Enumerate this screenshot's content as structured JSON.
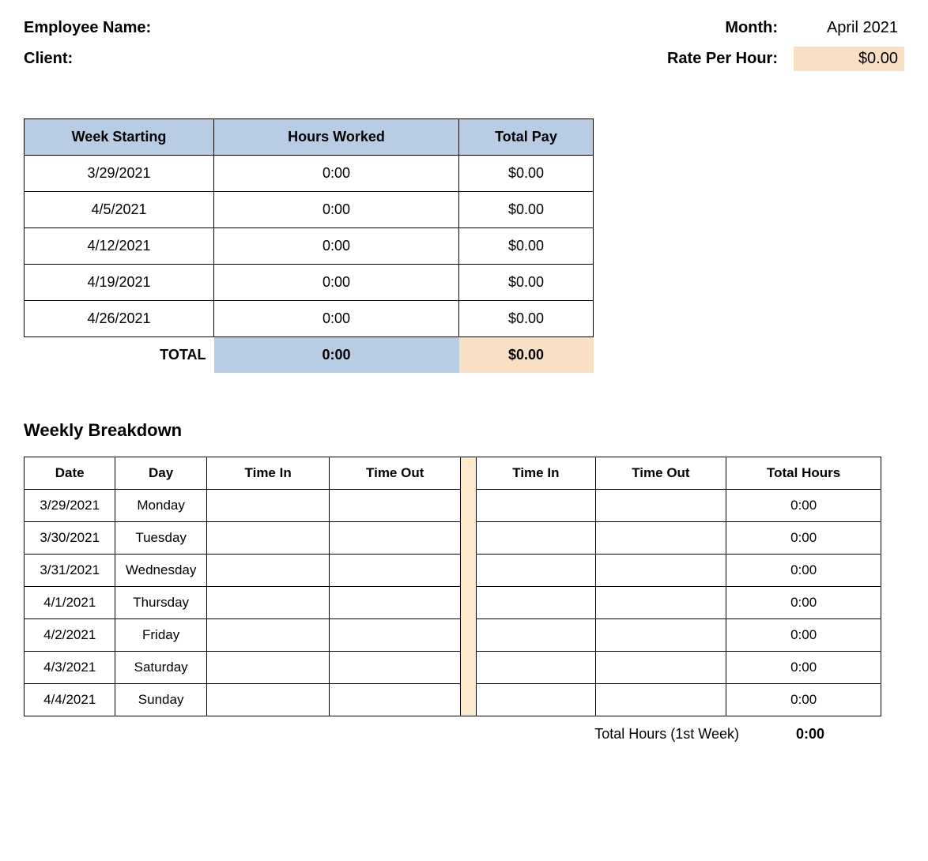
{
  "header": {
    "employee_name_label": "Employee Name:",
    "client_label": "Client:",
    "month_label": "Month:",
    "month_value": "April 2021",
    "rate_label": "Rate Per Hour:",
    "rate_value": "$0.00"
  },
  "summary": {
    "headers": {
      "week_starting": "Week Starting",
      "hours_worked": "Hours Worked",
      "total_pay": "Total Pay"
    },
    "rows": [
      {
        "week": "3/29/2021",
        "hours": "0:00",
        "pay": "$0.00"
      },
      {
        "week": "4/5/2021",
        "hours": "0:00",
        "pay": "$0.00"
      },
      {
        "week": "4/12/2021",
        "hours": "0:00",
        "pay": "$0.00"
      },
      {
        "week": "4/19/2021",
        "hours": "0:00",
        "pay": "$0.00"
      },
      {
        "week": "4/26/2021",
        "hours": "0:00",
        "pay": "$0.00"
      }
    ],
    "total": {
      "label": "TOTAL",
      "hours": "0:00",
      "pay": "$0.00"
    }
  },
  "breakdown": {
    "title": "Weekly Breakdown",
    "headers": {
      "date": "Date",
      "day": "Day",
      "time_in": "Time In",
      "time_out": "Time Out",
      "time_in2": "Time In",
      "time_out2": "Time Out",
      "total_hours": "Total Hours"
    },
    "rows": [
      {
        "date": "3/29/2021",
        "day": "Monday",
        "time_in": "",
        "time_out": "",
        "time_in2": "",
        "time_out2": "",
        "total_hours": "0:00"
      },
      {
        "date": "3/30/2021",
        "day": "Tuesday",
        "time_in": "",
        "time_out": "",
        "time_in2": "",
        "time_out2": "",
        "total_hours": "0:00"
      },
      {
        "date": "3/31/2021",
        "day": "Wednesday",
        "time_in": "",
        "time_out": "",
        "time_in2": "",
        "time_out2": "",
        "total_hours": "0:00"
      },
      {
        "date": "4/1/2021",
        "day": "Thursday",
        "time_in": "",
        "time_out": "",
        "time_in2": "",
        "time_out2": "",
        "total_hours": "0:00"
      },
      {
        "date": "4/2/2021",
        "day": "Friday",
        "time_in": "",
        "time_out": "",
        "time_in2": "",
        "time_out2": "",
        "total_hours": "0:00"
      },
      {
        "date": "4/3/2021",
        "day": "Saturday",
        "time_in": "",
        "time_out": "",
        "time_in2": "",
        "time_out2": "",
        "total_hours": "0:00"
      },
      {
        "date": "4/4/2021",
        "day": "Sunday",
        "time_in": "",
        "time_out": "",
        "time_in2": "",
        "time_out2": "",
        "total_hours": "0:00"
      }
    ],
    "footer": {
      "label": "Total Hours (1st Week)",
      "value": "0:00"
    }
  }
}
